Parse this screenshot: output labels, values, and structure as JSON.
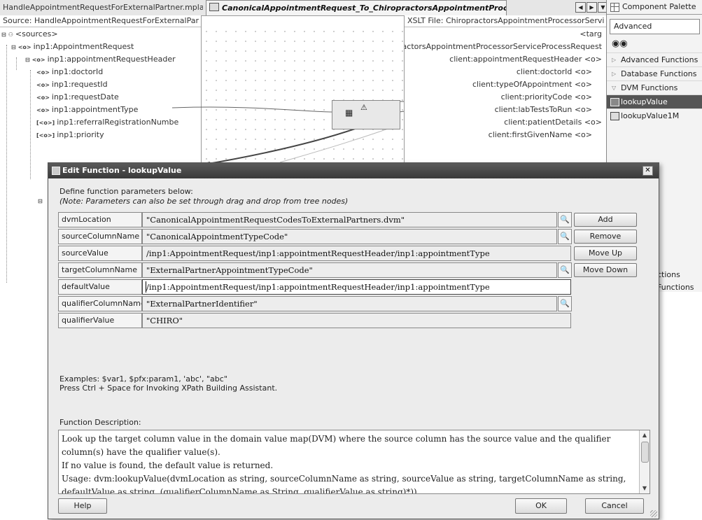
{
  "tabs": {
    "tab1": "HandleAppointmentRequestForExternalPartner.mplan",
    "tab2": "CanonicalAppointmentRequest_To_ChiropractorsAppointmentProcessor"
  },
  "source": {
    "header": "Source: HandleAppointmentRequestForExternalPar",
    "tree": [
      "<sources>",
      "inp1:AppointmentRequest",
      "inp1:appointmentRequestHeader",
      "inp1:doctorId",
      "inp1:requestId",
      "inp1:requestDate",
      "inp1:appointmentType",
      "inp1:referralRegistrationNumbe",
      "inp1:priority"
    ],
    "tags": [
      "<o>",
      "<o>",
      "<o>",
      "<o>",
      "<o>",
      "<o>",
      "[<o>]",
      "[<o>]"
    ]
  },
  "target": {
    "header": "XSLT File: ChiropractorsAppointmentProcessorServi",
    "rows": [
      "<targ",
      "actorsAppointmentProcessorServiceProcessRequest",
      "client:appointmentRequestHeader  <o>",
      "client:doctorId  <o>",
      "client:typeOfAppointment  <o>",
      "client:priorityCode  <o>",
      "client:labTestsToRun  <o>",
      "client:patientDetails  <o>",
      "client:firstGivenName  <o>"
    ]
  },
  "palette": {
    "title": "Component Palette",
    "selected": "Advanced",
    "items": [
      {
        "label": "Advanced Functions",
        "arrow": "▷"
      },
      {
        "label": "Database Functions",
        "arrow": "▷"
      },
      {
        "label": "DVM Functions",
        "arrow": "▽"
      }
    ],
    "functions": [
      "lookupValue",
      "lookupValue1M"
    ],
    "bottom": [
      "ctions",
      "Functions"
    ]
  },
  "dialog": {
    "title": "Edit Function - lookupValue",
    "close": "✕",
    "intro1": "Define function parameters below:",
    "intro2": "(Note: Parameters can also be set through drag and drop from tree nodes)",
    "params": [
      {
        "label": "dvmLocation",
        "value": "\"CanonicalAppointmentRequestCodesToExternalPartners.dvm\""
      },
      {
        "label": "sourceColumnName",
        "value": "\"CanonicalAppointmentTypeCode\""
      },
      {
        "label": "sourceValue",
        "value": "/inp1:AppointmentRequest/inp1:appointmentRequestHeader/inp1:appointmentType"
      },
      {
        "label": "targetColumnName",
        "value": "\"ExternalPartnerAppointmentTypeCode\""
      },
      {
        "label": "defaultValue",
        "value": "/inp1:AppointmentRequest/inp1:appointmentRequestHeader/inp1:appointmentType"
      },
      {
        "label": "qualifierColumnName",
        "value": "\"ExternalPartnerIdentifier\""
      },
      {
        "label": "qualifierValue",
        "value": "\"CHIRO\""
      }
    ],
    "buttons": {
      "add": "Add",
      "remove": "Remove",
      "move_up": "Move Up",
      "move_down": "Move Down",
      "help": "Help",
      "ok": "OK",
      "cancel": "Cancel"
    },
    "examples1": "Examples: $var1, $pfx:param1, 'abc', \"abc\"",
    "examples2": "Press Ctrl + Space for Invoking XPath Building Assistant.",
    "desc_label": "Function Description:",
    "desc_lines": [
      "Look up the target column value in the domain value map(DVM) where the source column has the source value and the qualifier column(s) have the qualifier value(s).",
      "If no value is found, the default value is returned.",
      "Usage: dvm:lookupValue(dvmLocation as string, sourceColumnName as string, sourceValue as string, targetColumnName as string, defaultValue as string, (qualifierColumnName as String, qualifierValue as string)*))"
    ]
  }
}
